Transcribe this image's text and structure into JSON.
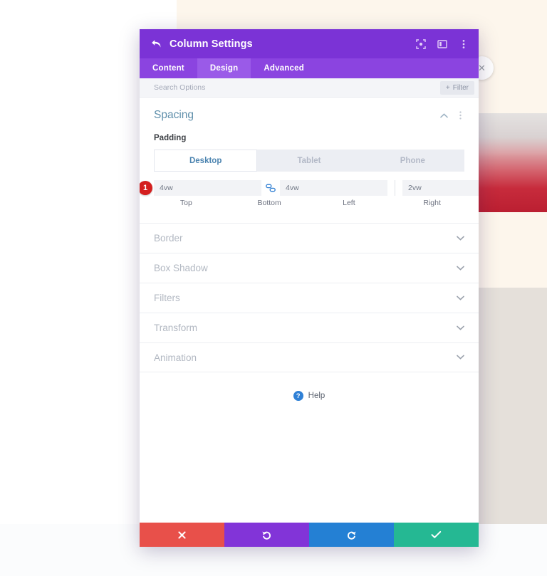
{
  "titlebar": {
    "title": "Column Settings",
    "back_icon": "back-arrow-icon",
    "icons": [
      {
        "name": "target-expand-icon",
        "glyph": "⧉"
      },
      {
        "name": "panel-layout-icon",
        "glyph": "▣"
      },
      {
        "name": "more-vertical-icon",
        "glyph": "⋮"
      }
    ]
  },
  "tabs": [
    {
      "label": "Content",
      "active": false
    },
    {
      "label": "Design",
      "active": true
    },
    {
      "label": "Advanced",
      "active": false
    }
  ],
  "search": {
    "placeholder": "Search Options",
    "value": "",
    "filter_label": "Filter",
    "filter_plus": "+"
  },
  "spacing": {
    "title": "Spacing",
    "collapse_icon": "chevron-up-icon",
    "menu_icon": "more-vertical-icon",
    "padding_label": "Padding",
    "devices": [
      {
        "label": "Desktop",
        "active": true
      },
      {
        "label": "Tablet",
        "active": false
      },
      {
        "label": "Phone",
        "active": false
      }
    ],
    "step_badge": "1",
    "fields": [
      {
        "value": "4vw",
        "label": "Top"
      },
      {
        "value": "4vw",
        "label": "Bottom"
      },
      {
        "value": "2vw",
        "label": "Left"
      },
      {
        "value": "2vw",
        "label": "Right"
      }
    ],
    "link_icon": "chain-link-icon"
  },
  "accordion": [
    {
      "label": "Border"
    },
    {
      "label": "Box Shadow"
    },
    {
      "label": "Filters"
    },
    {
      "label": "Transform"
    },
    {
      "label": "Animation"
    }
  ],
  "help": {
    "label": "Help",
    "icon_glyph": "?"
  },
  "footer": [
    {
      "name": "cancel-button",
      "glyph": "✖",
      "color": "#e8504a"
    },
    {
      "name": "undo-button",
      "glyph": "↺",
      "color": "#8234d8"
    },
    {
      "name": "redo-button",
      "glyph": "↻",
      "color": "#2480d4"
    },
    {
      "name": "save-button",
      "glyph": "✔",
      "color": "#25b893"
    }
  ],
  "background": {
    "close_glyph": "✕"
  },
  "colors": {
    "titlebar_purple": "#7b33d6",
    "tabbar_purple": "#8b44e0",
    "active_tab_purple": "#9a5ae8",
    "accent_blue": "#2d7dd2",
    "badge_red": "#d41f1f"
  }
}
